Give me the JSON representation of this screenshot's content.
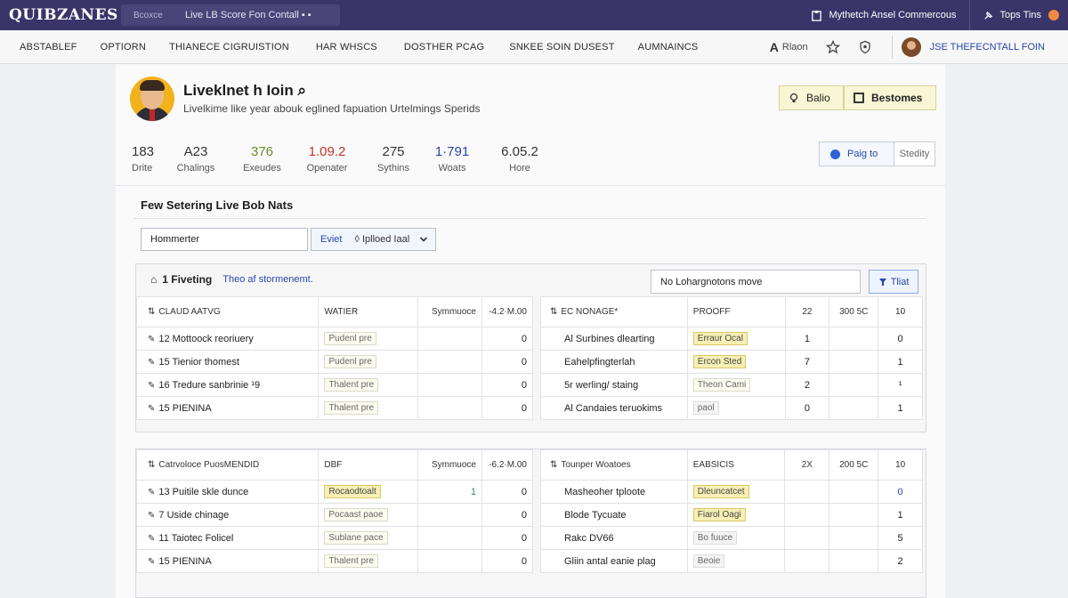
{
  "topbar": {
    "logo": "QUIBZANES",
    "search_prefix": "Bcoxce",
    "search_text": "Live LB Score Fon Contall ▪ ▪",
    "link1": "Mythetch Ansel Commercous",
    "link2": "Tops Tins"
  },
  "nav": {
    "items": [
      "ABSTABLEF",
      "OPTIORN",
      "THIANECE CIGRUISTION",
      "HAR WHSCS",
      "DOSTHER PCAG",
      "SNKEE SOIN DUSEST",
      "AUMNAINCS"
    ],
    "ar_glyph": "A",
    "ar_label": "Rlaon",
    "user_name": "JSE THEFECNTALL FOIN"
  },
  "profile": {
    "name": "Liveklnet h Ioin ⌕",
    "subtitle": "Livelkime like year abouk eglined fapuation Urtelmings Sperids",
    "btn1": "Balio",
    "btn2": "Bestomes"
  },
  "stats": [
    {
      "num": "183",
      "label": "Drite",
      "color": "#333333"
    },
    {
      "num": "A23",
      "label": "Chalings",
      "color": "#333333"
    },
    {
      "num": "376",
      "label": "Exeudes",
      "color": "#6b8a2a"
    },
    {
      "num": "1.09.2",
      "label": "Openater",
      "color": "#c0352b"
    },
    {
      "num": "275",
      "label": "Sythins",
      "color": "#333333"
    },
    {
      "num": "1·791",
      "label": "Woats",
      "color": "#2a46a8"
    },
    {
      "num": "6.05.2",
      "label": "Hore",
      "color": "#333333"
    }
  ],
  "actions": {
    "paig": "Paig to",
    "stedity": "Stedity"
  },
  "section": {
    "title": "Few Setering Live Bob Nats",
    "filter_value": "Hommerter",
    "select_a": "Eviet",
    "select_b": "◊ Iplloed Iaal"
  },
  "panel1": {
    "icon": "⌂",
    "title": "1 Fiveting",
    "subtitle": "Theo af stormenemt.",
    "input": "No Lohargnotons move",
    "btn": "Tliat",
    "left_header": [
      "CLAUD AATVG",
      "WATIER",
      "Symmuoce",
      "-4.2·M.00"
    ],
    "left_rows": [
      {
        "ic": "✎",
        "name": "12 Mottoock reoriuery",
        "tag": "Pudenl pre",
        "tagtype": "",
        "v1": "",
        "v2": "0"
      },
      {
        "ic": "✎",
        "name": "15 Tienior thomest",
        "tag": "Pudenl pre",
        "tagtype": "",
        "v1": "",
        "v2": "0"
      },
      {
        "ic": "✎",
        "name": "16 Tredure sanbrinie ¹9",
        "tag": "Thalent pre",
        "tagtype": "",
        "v1": "",
        "v2": "0"
      },
      {
        "ic": "✎",
        "name": "15 PIENINA",
        "tag": "Thalent pre",
        "tagtype": "",
        "v1": "",
        "v2": "0"
      }
    ],
    "right_header": [
      "EC NONAGE*",
      "PROOFF",
      "22",
      "300 5C",
      "10"
    ],
    "right_rows": [
      {
        "name": "Al Surbines dlearting",
        "tag": "Erraur Ocal",
        "tagtype": "hi",
        "c1": "1",
        "c2": "",
        "c3": "0"
      },
      {
        "name": "Eahelpfingterlah",
        "tag": "Ercon Sted",
        "tagtype": "hi",
        "c1": "7",
        "c2": "",
        "c3": "1"
      },
      {
        "name": "5r werling/ staing",
        "tag": "Theon Cami",
        "tagtype": "",
        "c1": "2",
        "c2": "",
        "c3": "¹"
      },
      {
        "name": "Al Candaies teruokims",
        "tag": "paol",
        "tagtype": "plain",
        "c1": "0",
        "c2": "",
        "c3": "1"
      }
    ]
  },
  "panel2": {
    "left_header": [
      "Catrvoloce PuosMENDID",
      "DBF",
      "Symmuoce",
      "-6.2·M.00"
    ],
    "left_rows": [
      {
        "ic": "✎",
        "name": "13 Puitile skle dunce",
        "tag": "Rocaodtoalt",
        "tagtype": "hi",
        "v1": "1",
        "v2": "0"
      },
      {
        "ic": "✎",
        "name": "7 Uside chinage",
        "tag": "Pocaast paoe",
        "tagtype": "",
        "v1": "",
        "v2": "0"
      },
      {
        "ic": "✎",
        "name": "11 Taiotec Folicel",
        "tag": "Sublane pace",
        "tagtype": "",
        "v1": "",
        "v2": "0"
      },
      {
        "ic": "✎",
        "name": "15 PIENINA",
        "tag": "Thalent pre",
        "tagtype": "",
        "v1": "",
        "v2": "0"
      }
    ],
    "right_header": [
      "Tounper Woatoes",
      "EABSICIS",
      "2X",
      "200 5C",
      "10"
    ],
    "right_rows": [
      {
        "name": "Masheoher tploote",
        "tag": "Dleuncatcet",
        "tagtype": "hi",
        "c1": "",
        "c2": "",
        "c3": "0"
      },
      {
        "name": "Blode Tycuate",
        "tag": "Fiarol Oagi",
        "tagtype": "hi",
        "c1": "",
        "c2": "",
        "c3": "1"
      },
      {
        "name": "Rakc DV66",
        "tag": "Bo fuuce",
        "tagtype": "plain",
        "c1": "",
        "c2": "",
        "c3": "5"
      },
      {
        "name": "Gliin antal eanie plag",
        "tag": "Beoie",
        "tagtype": "plain",
        "c1": "",
        "c2": "",
        "c3": "2"
      }
    ]
  }
}
